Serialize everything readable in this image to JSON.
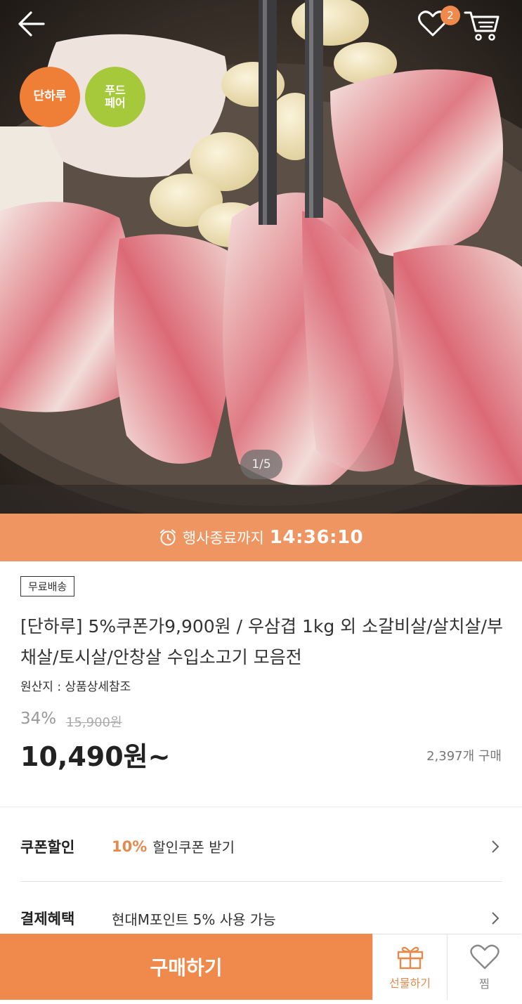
{
  "header": {
    "back_icon": "arrow-left-icon",
    "wishlist_icon": "heart-outline-icon",
    "wishlist_count": "2",
    "cart_icon": "cart-icon"
  },
  "hero": {
    "badges": [
      "단하루",
      "푸드",
      "페어"
    ],
    "pager": "1/5"
  },
  "timer": {
    "icon": "alarm-clock-icon",
    "label": "행사종료까지",
    "value": "14:36:10"
  },
  "product": {
    "shipping_tag": "무료배송",
    "title": "[단하루] 5%쿠폰가9,900원 / 우삼겹 1kg 외 소갈비살/살치살/부채살/토시살/안창살 수입소고기 모음전",
    "origin": "원산지 : 상품상세참조",
    "discount": "34%",
    "original_price": "15,900원",
    "price": "10,490원~",
    "purchase_count": "2,397개 구매"
  },
  "benefits": {
    "coupon": {
      "label": "쿠폰할인",
      "accent": "10%",
      "text": "할인쿠폰 받기"
    },
    "payment": {
      "label": "결제혜택",
      "text": "현대M포인트 5% 사용 가능"
    }
  },
  "bottom_bar": {
    "buy_label": "구매하기",
    "gift_label": "선물하기",
    "zzim_label": "찜"
  },
  "colors": {
    "accent_orange": "#ef8a4c",
    "timer_orange": "#ef9562",
    "badge_green": "#a6c93c"
  }
}
